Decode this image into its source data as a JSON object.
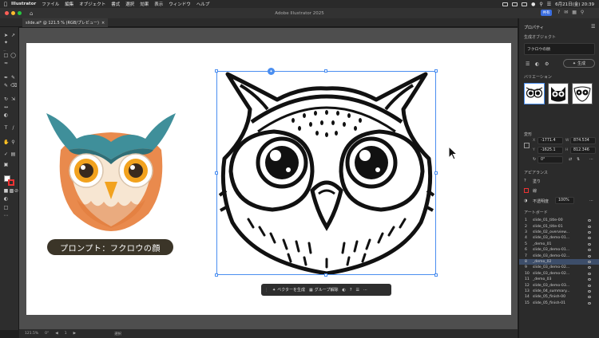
{
  "menubar": {
    "app_name": "Illustrator",
    "items": [
      "ファイル",
      "編集",
      "オブジェクト",
      "書式",
      "選択",
      "効果",
      "表示",
      "ウィンドウ",
      "ヘルプ"
    ],
    "datetime": "6月21日(金) 20:39"
  },
  "window": {
    "title": "Adobe Illustrator 2025",
    "share_label": "共有",
    "doc_tab": "slide.ai* @ 121.5 % (RGB/プレビュー)"
  },
  "artwork": {
    "prompt_label": "プロンプト：フクロウの顔"
  },
  "context_bar": {
    "vectorize_label": "ベクターを生成",
    "ungroup_label": "グループ解除"
  },
  "status": {
    "zoom": "121.5%",
    "rotation": "0°",
    "artboard_nav": "1",
    "mode": "選択"
  },
  "panel": {
    "tab": "プロパティ",
    "gen_object_title": "生成オブジェクト",
    "prompt_field": "フクロウの顔",
    "gen_button": "生成",
    "variations_title": "バリエーション",
    "transform_title": "変形",
    "x": "-1771.4",
    "y": "-1625.1",
    "w": "874.534",
    "h": "812.346",
    "angle": "0°",
    "appearance_title": "アピアランス",
    "fill_label": "塗り",
    "stroke_label": "線",
    "opacity_label": "不透明度",
    "opacity_value": "100%",
    "artboards_title": "アートボード",
    "artboards": [
      {
        "num": "1",
        "name": "slide_01_title-00"
      },
      {
        "num": "2",
        "name": "slide_01_title-01"
      },
      {
        "num": "3",
        "name": "slide_02_overview..."
      },
      {
        "num": "4",
        "name": "slide_03_demo-01..."
      },
      {
        "num": "5",
        "name": "_demo_01"
      },
      {
        "num": "6",
        "name": "slide_03_demo-01..."
      },
      {
        "num": "7",
        "name": "slide_03_demo-02..."
      },
      {
        "num": "8",
        "name": "_demo_02"
      },
      {
        "num": "9",
        "name": "slide_03_demo-02..."
      },
      {
        "num": "10",
        "name": "slide_03_demo-02..."
      },
      {
        "num": "11",
        "name": "_demo_03"
      },
      {
        "num": "12",
        "name": "slide_03_demo-03..."
      },
      {
        "num": "13",
        "name": "slide_04_summary..."
      },
      {
        "num": "14",
        "name": "slide_05_finish-00"
      },
      {
        "num": "15",
        "name": "slide_05_finish-01"
      }
    ],
    "highlighted_artboard": "8"
  },
  "colors": {
    "accent": "#4a8ef0",
    "canvas": "#4e4e4e",
    "owl_teal": "#3f8f9a",
    "owl_orange": "#e98a4d",
    "owl_eye": "#f2a21e"
  }
}
